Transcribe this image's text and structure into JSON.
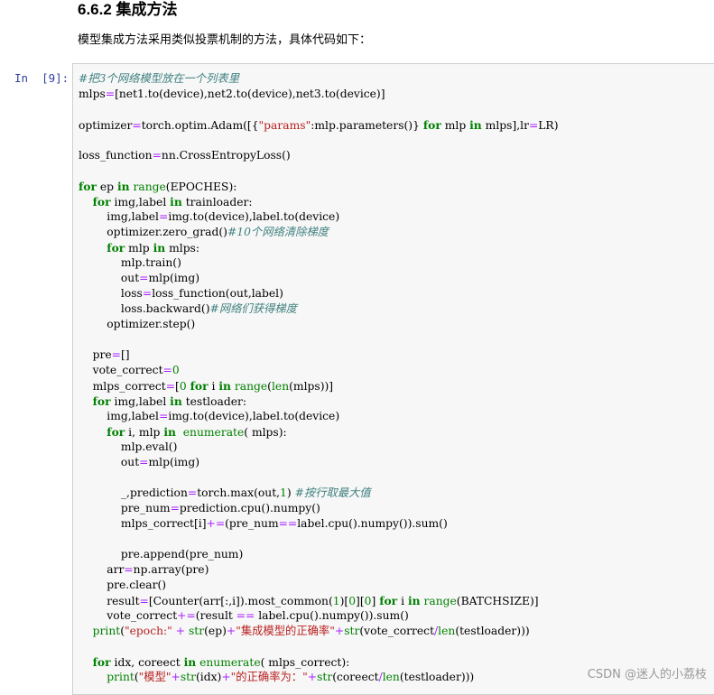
{
  "section": {
    "heading": "6.6.2 集成方法",
    "description": "模型集成方法采用类似投票机制的方法，具体代码如下："
  },
  "cell": {
    "prompt": "In  [9]:",
    "lines": [
      [
        [
          "cm",
          "#把3个网络模型放在一个列表里"
        ]
      ],
      [
        [
          "t",
          "mlps"
        ],
        [
          "op",
          "="
        ],
        [
          "t",
          "[net1.to(device),net2.to(device),net3.to(device)]"
        ]
      ],
      [],
      [
        [
          "t",
          "optimizer"
        ],
        [
          "op",
          "="
        ],
        [
          "t",
          "torch.optim.Adam([{"
        ],
        [
          "st",
          "\"params\""
        ],
        [
          "t",
          ":mlp.parameters()} "
        ],
        [
          "kw",
          "for"
        ],
        [
          "t",
          " mlp "
        ],
        [
          "kw",
          "in"
        ],
        [
          "t",
          " mlps],lr"
        ],
        [
          "op",
          "="
        ],
        [
          "t",
          "LR)"
        ]
      ],
      [],
      [
        [
          "t",
          "loss_function"
        ],
        [
          "op",
          "="
        ],
        [
          "t",
          "nn.CrossEntropyLoss()"
        ]
      ],
      [],
      [
        [
          "kw",
          "for"
        ],
        [
          "t",
          " ep "
        ],
        [
          "kw",
          "in"
        ],
        [
          "t",
          " "
        ],
        [
          "bi",
          "range"
        ],
        [
          "t",
          "(EPOCHES):"
        ]
      ],
      [
        [
          "t",
          "    "
        ],
        [
          "kw",
          "for"
        ],
        [
          "t",
          " img,label "
        ],
        [
          "kw",
          "in"
        ],
        [
          "t",
          " trainloader:"
        ]
      ],
      [
        [
          "t",
          "        img,label"
        ],
        [
          "op",
          "="
        ],
        [
          "t",
          "img.to(device),label.to(device)"
        ]
      ],
      [
        [
          "t",
          "        optimizer.zero_grad()"
        ],
        [
          "cm",
          "#10个网络清除梯度"
        ]
      ],
      [
        [
          "t",
          "        "
        ],
        [
          "kw",
          "for"
        ],
        [
          "t",
          " mlp "
        ],
        [
          "kw",
          "in"
        ],
        [
          "t",
          " mlps:"
        ]
      ],
      [
        [
          "t",
          "            mlp.train()"
        ]
      ],
      [
        [
          "t",
          "            out"
        ],
        [
          "op",
          "="
        ],
        [
          "t",
          "mlp(img)"
        ]
      ],
      [
        [
          "t",
          "            loss"
        ],
        [
          "op",
          "="
        ],
        [
          "t",
          "loss_function(out,label)"
        ]
      ],
      [
        [
          "t",
          "            loss.backward()"
        ],
        [
          "cm",
          "#网络们获得梯度"
        ]
      ],
      [
        [
          "t",
          "        optimizer.step()"
        ]
      ],
      [],
      [
        [
          "t",
          "    pre"
        ],
        [
          "op",
          "="
        ],
        [
          "t",
          "[]"
        ]
      ],
      [
        [
          "t",
          "    vote_correct"
        ],
        [
          "op",
          "="
        ],
        [
          "nm",
          "0"
        ]
      ],
      [
        [
          "t",
          "    mlps_correct"
        ],
        [
          "op",
          "="
        ],
        [
          "t",
          "["
        ],
        [
          "nm",
          "0"
        ],
        [
          "t",
          " "
        ],
        [
          "kw",
          "for"
        ],
        [
          "t",
          " i "
        ],
        [
          "kw",
          "in"
        ],
        [
          "t",
          " "
        ],
        [
          "bi",
          "range"
        ],
        [
          "t",
          "("
        ],
        [
          "bi",
          "len"
        ],
        [
          "t",
          "(mlps))]"
        ]
      ],
      [
        [
          "t",
          "    "
        ],
        [
          "kw",
          "for"
        ],
        [
          "t",
          " img,label "
        ],
        [
          "kw",
          "in"
        ],
        [
          "t",
          " testloader:"
        ]
      ],
      [
        [
          "t",
          "        img,label"
        ],
        [
          "op",
          "="
        ],
        [
          "t",
          "img.to(device),label.to(device)"
        ]
      ],
      [
        [
          "t",
          "        "
        ],
        [
          "kw",
          "for"
        ],
        [
          "t",
          " i, mlp "
        ],
        [
          "kw",
          "in"
        ],
        [
          "t",
          "  "
        ],
        [
          "bi",
          "enumerate"
        ],
        [
          "t",
          "( mlps):"
        ]
      ],
      [
        [
          "t",
          "            mlp.eval()"
        ]
      ],
      [
        [
          "t",
          "            out"
        ],
        [
          "op",
          "="
        ],
        [
          "t",
          "mlp(img)"
        ]
      ],
      [],
      [
        [
          "t",
          "            _,prediction"
        ],
        [
          "op",
          "="
        ],
        [
          "t",
          "torch.max(out,"
        ],
        [
          "nm",
          "1"
        ],
        [
          "t",
          ") "
        ],
        [
          "cm",
          "#按行取最大值"
        ]
      ],
      [
        [
          "t",
          "            pre_num"
        ],
        [
          "op",
          "="
        ],
        [
          "t",
          "prediction.cpu().numpy()"
        ]
      ],
      [
        [
          "t",
          "            mlps_correct[i]"
        ],
        [
          "op",
          "+="
        ],
        [
          "t",
          "(pre_num"
        ],
        [
          "op",
          "=="
        ],
        [
          "t",
          "label.cpu().numpy()).sum()"
        ]
      ],
      [],
      [
        [
          "t",
          "            pre.append(pre_num)"
        ]
      ],
      [
        [
          "t",
          "        arr"
        ],
        [
          "op",
          "="
        ],
        [
          "t",
          "np.array(pre)"
        ]
      ],
      [
        [
          "t",
          "        pre.clear()"
        ]
      ],
      [
        [
          "t",
          "        result"
        ],
        [
          "op",
          "="
        ],
        [
          "t",
          "[Counter(arr[:,i]).most_common("
        ],
        [
          "nm",
          "1"
        ],
        [
          "t",
          ")["
        ],
        [
          "nm",
          "0"
        ],
        [
          "t",
          "]["
        ],
        [
          "nm",
          "0"
        ],
        [
          "t",
          "] "
        ],
        [
          "kw",
          "for"
        ],
        [
          "t",
          " i "
        ],
        [
          "kw",
          "in"
        ],
        [
          "t",
          " "
        ],
        [
          "bi",
          "range"
        ],
        [
          "t",
          "(BATCHSIZE)]"
        ]
      ],
      [
        [
          "t",
          "        vote_correct"
        ],
        [
          "op",
          "+="
        ],
        [
          "t",
          "(result "
        ],
        [
          "op",
          "=="
        ],
        [
          "t",
          " label.cpu().numpy()).sum()"
        ]
      ],
      [
        [
          "t",
          "    "
        ],
        [
          "bi",
          "print"
        ],
        [
          "t",
          "("
        ],
        [
          "st",
          "\"epoch:\""
        ],
        [
          "t",
          " "
        ],
        [
          "op",
          "+"
        ],
        [
          "t",
          " "
        ],
        [
          "bi",
          "str"
        ],
        [
          "t",
          "(ep)"
        ],
        [
          "op",
          "+"
        ],
        [
          "st",
          "\"集成模型的正确率\""
        ],
        [
          "op",
          "+"
        ],
        [
          "bi",
          "str"
        ],
        [
          "t",
          "(vote_correct"
        ],
        [
          "op",
          "/"
        ],
        [
          "bi",
          "len"
        ],
        [
          "t",
          "(testloader)))"
        ]
      ],
      [],
      [
        [
          "t",
          "    "
        ],
        [
          "kw",
          "for"
        ],
        [
          "t",
          " idx, coreect "
        ],
        [
          "kw",
          "in"
        ],
        [
          "t",
          " "
        ],
        [
          "bi",
          "enumerate"
        ],
        [
          "t",
          "( mlps_correct):"
        ]
      ],
      [
        [
          "t",
          "        "
        ],
        [
          "bi",
          "print"
        ],
        [
          "t",
          "("
        ],
        [
          "st",
          "\"模型\""
        ],
        [
          "op",
          "+"
        ],
        [
          "bi",
          "str"
        ],
        [
          "t",
          "(idx)"
        ],
        [
          "op",
          "+"
        ],
        [
          "st",
          "\"的正确率为：\""
        ],
        [
          "op",
          "+"
        ],
        [
          "bi",
          "str"
        ],
        [
          "t",
          "(coreect"
        ],
        [
          "op",
          "/"
        ],
        [
          "bi",
          "len"
        ],
        [
          "t",
          "(testloader)))"
        ]
      ]
    ]
  },
  "watermark": "CSDN @迷人的小荔枝",
  "colors": {
    "keyword": "#008000",
    "operator": "#aa22ff",
    "comment": "#408080",
    "string": "#ba2121",
    "prompt": "#303f9f",
    "cell_background": "#f7f7f7"
  }
}
